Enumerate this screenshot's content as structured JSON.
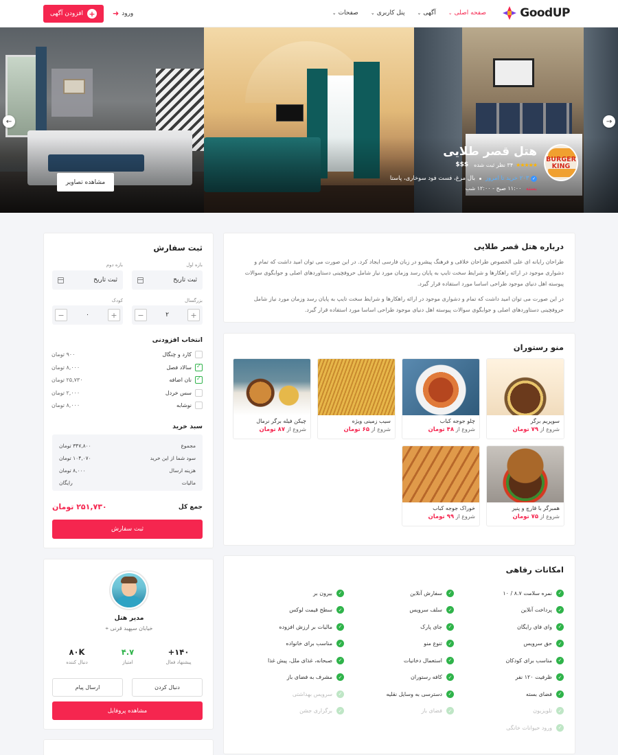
{
  "brand": {
    "name": "GoodUP",
    "accent": "#f5264f"
  },
  "nav": [
    {
      "label": "صفحه اصلی",
      "active": true
    },
    {
      "label": "آگهی",
      "active": false
    },
    {
      "label": "پنل کاربری",
      "active": false
    },
    {
      "label": "صفحات",
      "active": false
    }
  ],
  "header": {
    "login_label": "ورود",
    "add_listing_label": "افزودن آگهی"
  },
  "hero": {
    "brand_logo_text_1": "BURGER",
    "brand_logo_text_2": "KING",
    "title": "هتل قصر طلایی",
    "stars": "★★★★★",
    "reviews": "۳۴ نظر ثبت شده",
    "price_level": "$$$",
    "bought_today": "۲۰۳ خرید تا امروز",
    "tags": "بال مرغ، فست فود سوخاری، پاستا",
    "status": "بسته",
    "hours": "۱۱:۰۰ صبح - ۱۲:۰۰ شب",
    "view_photos": "مشاهده تصاویر"
  },
  "about": {
    "title": "درباره هتل قصر طلایی",
    "p1": "طراحان رایانه ای علی الخصوص طراحان خلاقی و فرهنگ پیشرو در زبان فارسی ایجاد کرد. در این صورت می توان امید داشت که تمام و دشواری موجود در ارائه راهکارها و شرایط سخت تایپ به پایان رسد وزمان مورد نیاز شامل حروفچینی دستاوردهای اصلی و جوابگوی سوالات پیوسته اهل دنیای موجود طراحی اساسا مورد استفاده قرار گیرد.",
    "p2": "در این صورت می توان امید داشت که تمام و دشواری موجود در ارائه راهکارها و شرایط سخت تایپ به پایان رسد وزمان مورد نیاز شامل حروفچینی دستاوردهای اصلی و جوابگوی سوالات پیوسته اهل دنیای موجود طراحی اساسا مورد استفاده قرار گیرد."
  },
  "menu": {
    "title": "منو رستوران",
    "price_prefix": "شروع از",
    "items": [
      {
        "name": "سوپریم برگر",
        "price": "۷۹ تومان",
        "icon": "burger-dish"
      },
      {
        "name": "چلو جوجه کباب",
        "price": "۴۸ تومان",
        "icon": "kebab-dish"
      },
      {
        "name": "سیب زمینی ویژه",
        "price": "۶۵ تومان",
        "icon": "fries-dish"
      },
      {
        "name": "چیکن فیله برگر نرمال",
        "price": "۸۷ تومان",
        "icon": "chicken-burger-dish"
      },
      {
        "name": "همبرگر با قارچ و پنیر",
        "price": "۷۵ تومان",
        "icon": "mushroom-burger-dish"
      },
      {
        "name": "خوراک جوجه کباب",
        "price": "۹۹ تومان",
        "icon": "grilled-chicken-dish"
      }
    ]
  },
  "amenities": {
    "title": "امکانات رفاهی",
    "columns": [
      [
        {
          "label": "نمره سلامت ۸.۷ / ۱۰",
          "enabled": true
        },
        {
          "label": "پرداخت آنلاین",
          "enabled": true
        },
        {
          "label": "وای فای رایگان",
          "enabled": true
        },
        {
          "label": "حق سرویس",
          "enabled": true
        },
        {
          "label": "مناسب برای کودکان",
          "enabled": true
        },
        {
          "label": "ظرفیت ۱۲۰ نفر",
          "enabled": true
        },
        {
          "label": "فضای بسته",
          "enabled": true
        },
        {
          "label": "تلویزیون",
          "enabled": false
        },
        {
          "label": "ورود حیوانات خانگی",
          "enabled": false
        }
      ],
      [
        {
          "label": "سفارش آنلاین",
          "enabled": true
        },
        {
          "label": "سلف سرویس",
          "enabled": true
        },
        {
          "label": "جای پارک",
          "enabled": true
        },
        {
          "label": "تنوع منو",
          "enabled": true
        },
        {
          "label": "استعمال دخانیات",
          "enabled": true
        },
        {
          "label": "کافه رستوران",
          "enabled": true
        },
        {
          "label": "دسترسی به وسایل نقلیه",
          "enabled": true
        },
        {
          "label": "فضای باز",
          "enabled": false
        }
      ],
      [
        {
          "label": "بیرون بر",
          "enabled": true
        },
        {
          "label": "سطح قیمت لوکس",
          "enabled": true
        },
        {
          "label": "مالیات بر ارزش افزوده",
          "enabled": true
        },
        {
          "label": "مناسب برای خانواده",
          "enabled": true
        },
        {
          "label": "صبحانه، غذای ملل، پیش غذا",
          "enabled": true
        },
        {
          "label": "مشرف به فضای باز",
          "enabled": true
        },
        {
          "label": "سرویس بهداشتی",
          "enabled": false
        },
        {
          "label": "برگزاری جشن",
          "enabled": false
        }
      ]
    ]
  },
  "order": {
    "title": "ثبت سفارش",
    "range1_label": "بازه اول",
    "range2_label": "بازه دوم",
    "date_placeholder": "ثبت تاریخ",
    "adult_label": "بزرگسال",
    "child_label": "کودک",
    "adult_value": "۲",
    "child_value": "۰",
    "addons_title": "انتخاب افزودنی",
    "addons": [
      {
        "name": "کارد و چنگال",
        "price": "۹۰۰ تومان",
        "checked": false
      },
      {
        "name": "سالاد فصل",
        "price": "۸,۰۰۰ تومان",
        "checked": true
      },
      {
        "name": "نان اضافه",
        "price": "۲۵,۷۳۰ تومان",
        "checked": true
      },
      {
        "name": "سس خردل",
        "price": "۲,۰۰۰ تومان",
        "checked": false
      },
      {
        "name": "نوشابه",
        "price": "۸,۰۰۰ تومان",
        "checked": false
      }
    ],
    "cart_title": "سبد خرید",
    "cart": [
      {
        "label": "مجموع",
        "value": "۳۴۷,۸۰۰ تومان"
      },
      {
        "label": "سود شما از این خرید",
        "value": "۱۰۴,۰۷۰ تومان"
      },
      {
        "label": "هزینه ارسال",
        "value": "۸,۰۰۰ تومان"
      },
      {
        "label": "مالیات",
        "value": "رایگان"
      }
    ],
    "total_label": "جمع کل",
    "total_value": "۲۵۱,۷۳۰ تومان",
    "submit_label": "ثبت سفارش"
  },
  "profile": {
    "name": "مدیر هتل",
    "address": "خیابان سپهبد قرنی",
    "stats": [
      {
        "value": "۱۴۰+",
        "label": "پیشنهاد فعال"
      },
      {
        "value": "۴.۷",
        "label": "امتیاز"
      },
      {
        "value": "۸۰K",
        "label": "دنبال کننده"
      }
    ],
    "follow_label": "دنبال کردن",
    "message_label": "ارسال پیام",
    "view_profile_label": "مشاهده پروفایل"
  }
}
